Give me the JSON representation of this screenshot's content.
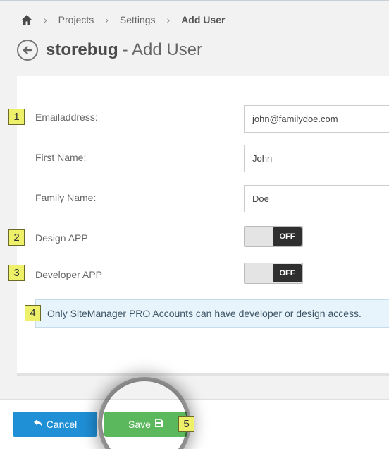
{
  "breadcrumb": {
    "home_icon": "home-icon",
    "items": [
      "Projects",
      "Settings"
    ],
    "current": "Add User"
  },
  "header": {
    "back_icon": "arrow-left-icon",
    "project": "storebug",
    "subtitle": "- Add User"
  },
  "form": {
    "email_label": "Emailaddress:",
    "email_value": "john@familydoe.com",
    "first_name_label": "First Name:",
    "first_name_value": "John",
    "family_name_label": "Family Name:",
    "family_name_value": "Doe",
    "design_label": "Design APP",
    "design_state": "OFF",
    "developer_label": "Developer APP",
    "developer_state": "OFF",
    "info_text": "Only SiteManager PRO Accounts can have developer or design access."
  },
  "markers": [
    "1",
    "2",
    "3",
    "4",
    "5"
  ],
  "footer": {
    "cancel_label": "Cancel",
    "cancel_icon": "undo-arrow-icon",
    "save_label": "Save",
    "save_icon": "floppy-disk-icon"
  },
  "colors": {
    "primary": "#1f8fd6",
    "success": "#5cb85c",
    "marker": "#eef06a",
    "info_bg": "#e8f4fb"
  }
}
